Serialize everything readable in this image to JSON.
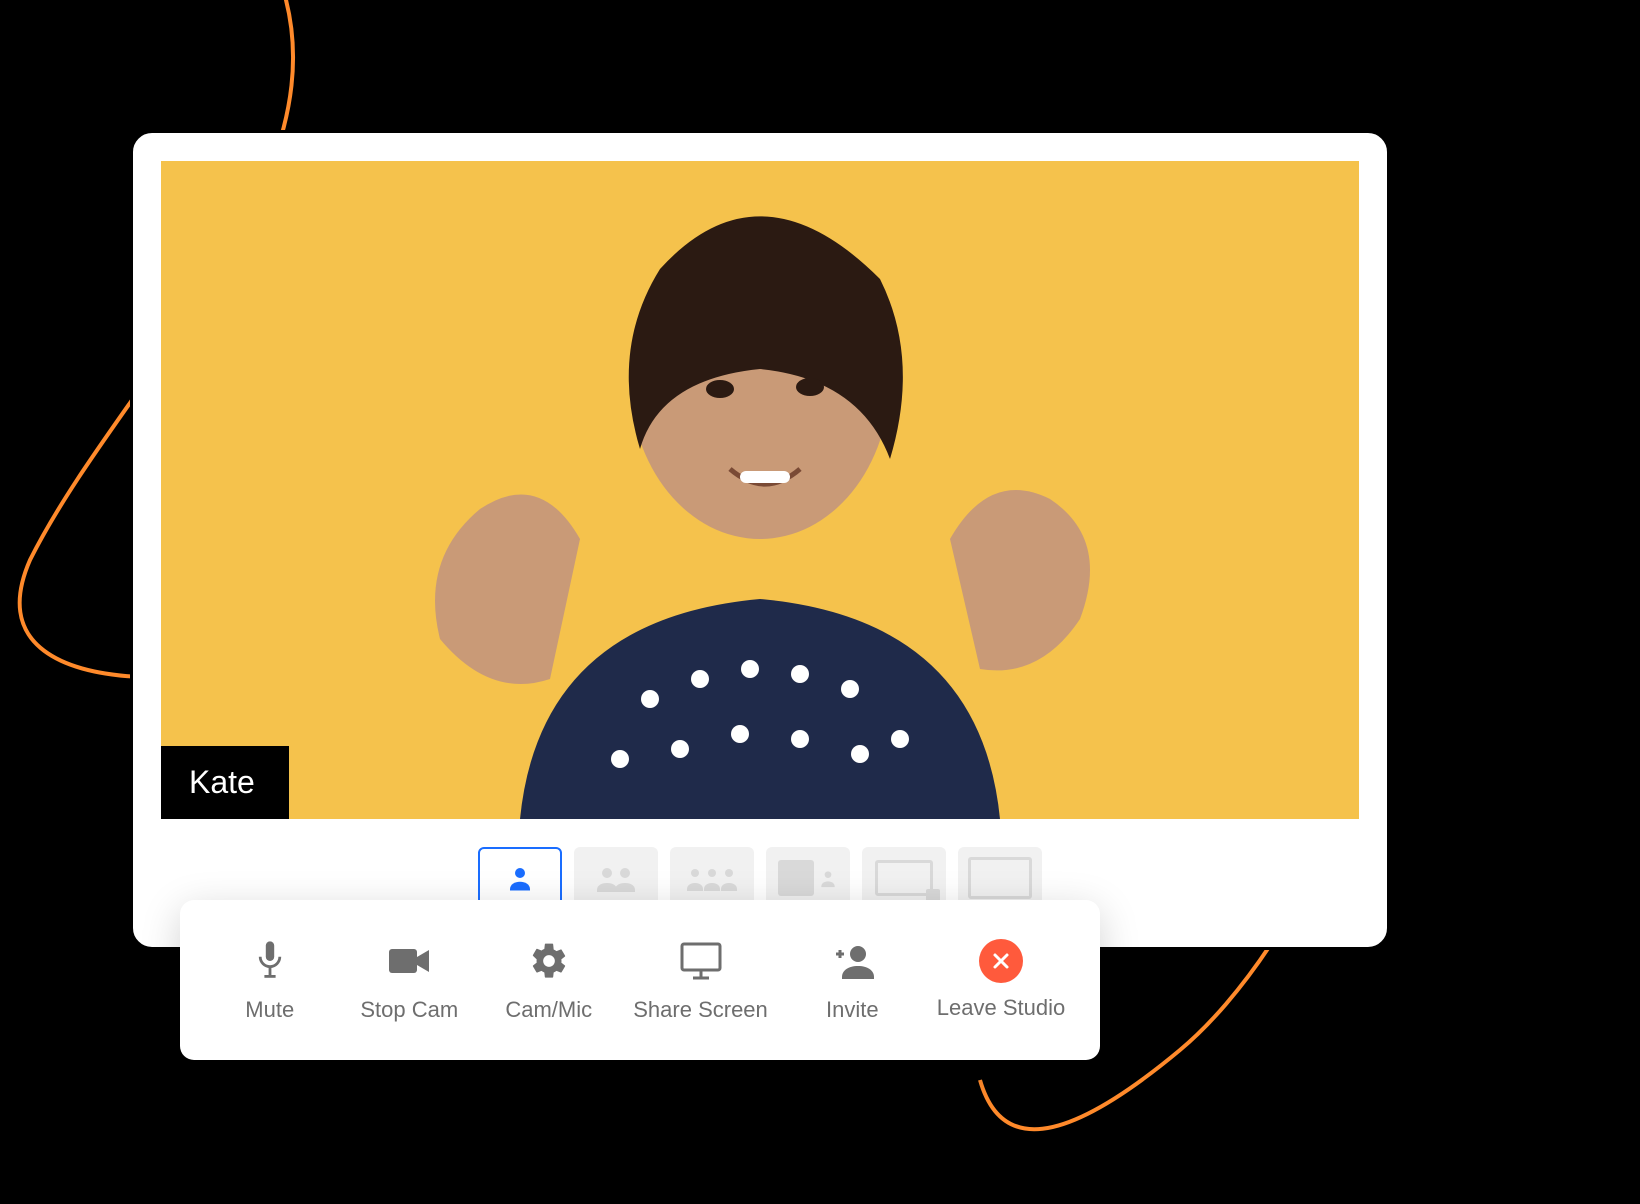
{
  "participant": {
    "name": "Kate"
  },
  "colors": {
    "video_bg": "#f5c24c",
    "accent": "#1a6dff",
    "leave": "#ff5a3c",
    "swirl": "#ff8a2b"
  },
  "layouts": [
    {
      "id": "solo",
      "selected": true
    },
    {
      "id": "duo",
      "selected": false
    },
    {
      "id": "trio",
      "selected": false
    },
    {
      "id": "screen-thumb",
      "selected": false
    },
    {
      "id": "screen-wide",
      "selected": false
    },
    {
      "id": "screen-only",
      "selected": false
    }
  ],
  "controls": {
    "mute": "Mute",
    "stop_cam": "Stop Cam",
    "cam_mic": "Cam/Mic",
    "share_screen": "Share Screen",
    "invite": "Invite",
    "leave": "Leave Studio"
  }
}
